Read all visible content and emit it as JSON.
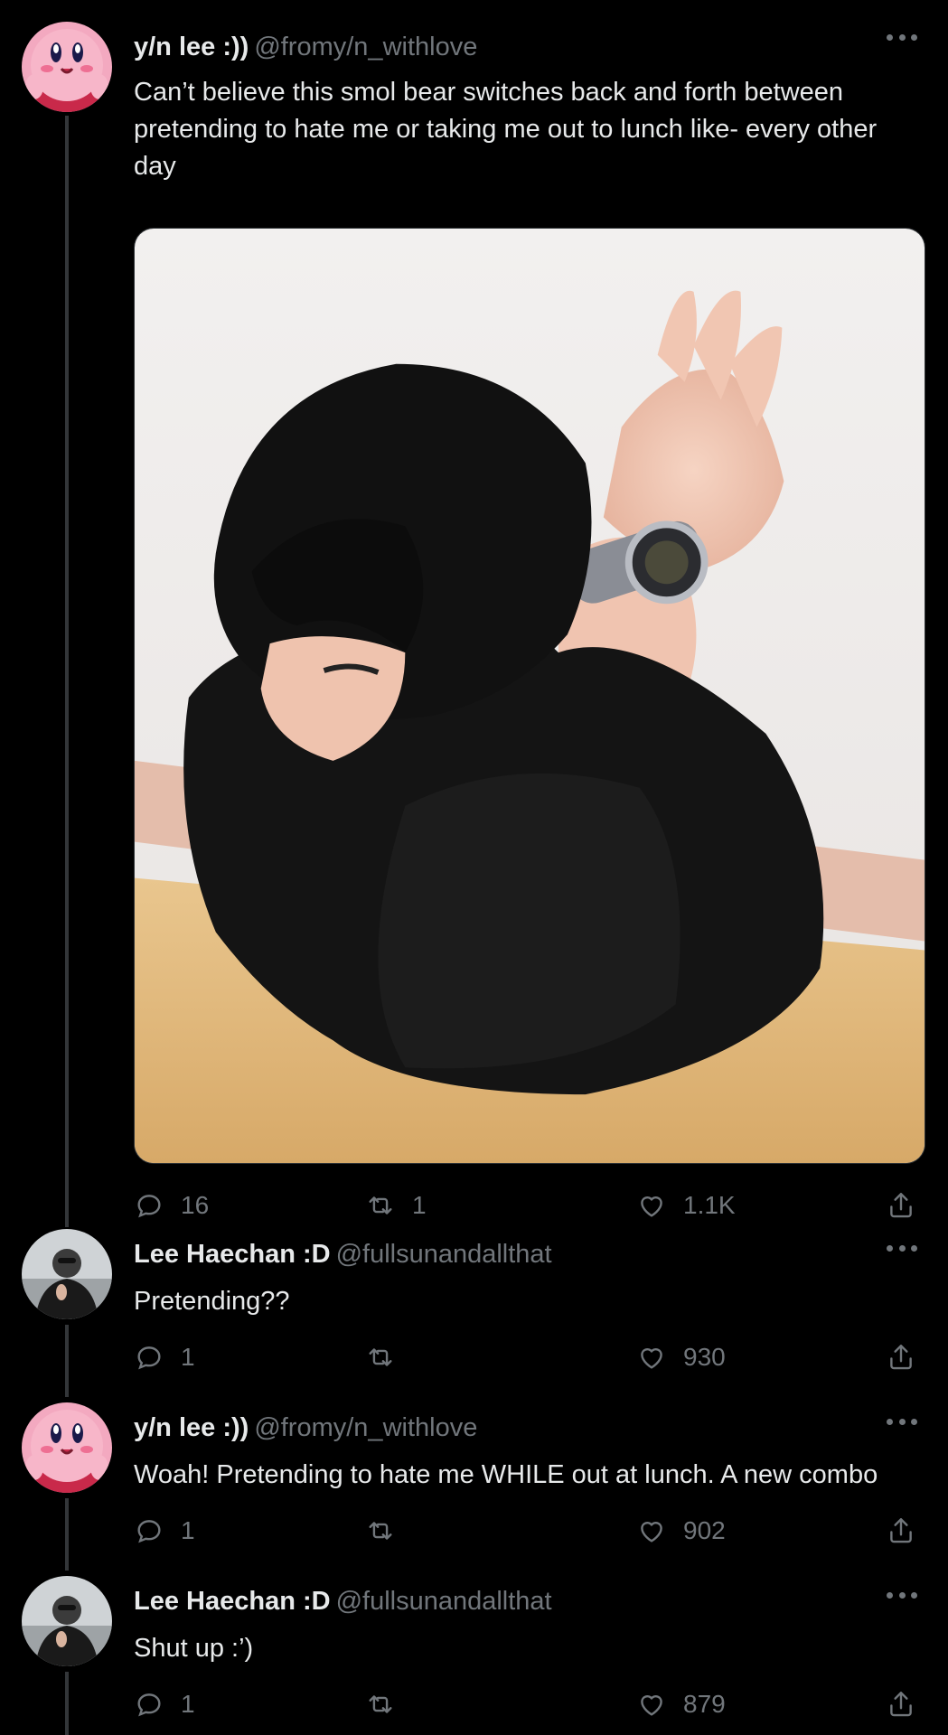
{
  "tweets": [
    {
      "display_name": "y/n lee :))",
      "handle": "@fromy/n_withlove",
      "avatar_icon": "kirby-avatar",
      "text_lines": [
        "Can’t believe this smol bear switches back and forth between",
        "pretending to hate me or taking me out to lunch like- every other",
        "day"
      ],
      "has_media": true,
      "media_description_icon": "photo-person-black-sweater-watch",
      "replies": "16",
      "retweets": "1",
      "likes": "1.1K"
    },
    {
      "display_name": "Lee Haechan :D",
      "handle": "@fullsunandallthat",
      "avatar_icon": "person-photo-avatar",
      "text_lines": [
        "Pretending??"
      ],
      "replies": "1",
      "retweets": "",
      "likes": "930"
    },
    {
      "display_name": "y/n lee :))",
      "handle": "@fromy/n_withlove",
      "avatar_icon": "kirby-avatar",
      "text_lines": [
        "Woah! Pretending to hate me WHILE out at lunch. A new combo"
      ],
      "replies": "1",
      "retweets": "",
      "likes": "902"
    },
    {
      "display_name": "Lee Haechan :D",
      "handle": "@fullsunandallthat",
      "avatar_icon": "person-photo-avatar",
      "text_lines": [
        "Shut up :’)"
      ],
      "replies": "1",
      "retweets": "",
      "likes": "879"
    }
  ],
  "colors": {
    "background": "#000000",
    "text": "#e7e9ea",
    "muted": "#71767b",
    "thread_line": "#333639"
  }
}
